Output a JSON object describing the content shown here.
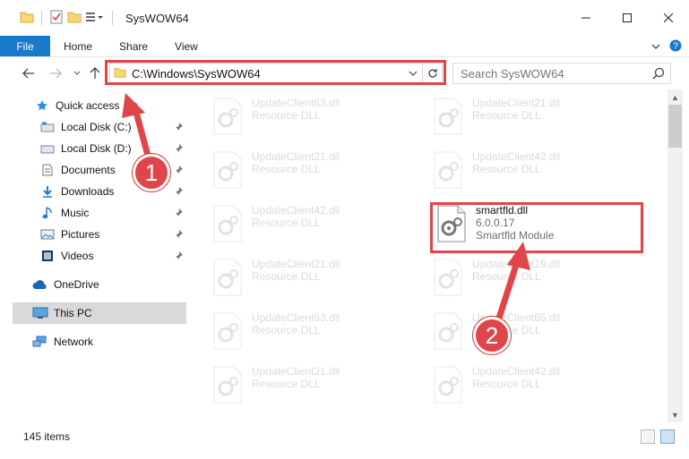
{
  "window": {
    "title": "SysWOW64"
  },
  "ribbon": {
    "tabs": [
      "File",
      "Home",
      "Share",
      "View"
    ]
  },
  "address": {
    "path": "C:\\Windows\\SysWOW64"
  },
  "search": {
    "placeholder": "Search SysWOW64"
  },
  "nav": {
    "quick_access": "Quick access",
    "items": [
      {
        "label": "Local Disk (C:)",
        "icon": "drive-icon",
        "pinned": true
      },
      {
        "label": "Local Disk (D:)",
        "icon": "drive-icon",
        "pinned": true
      },
      {
        "label": "Documents",
        "icon": "documents-icon",
        "pinned": true
      },
      {
        "label": "Downloads",
        "icon": "downloads-icon",
        "pinned": true
      },
      {
        "label": "Music",
        "icon": "music-icon",
        "pinned": true
      },
      {
        "label": "Pictures",
        "icon": "pictures-icon",
        "pinned": true
      },
      {
        "label": "Videos",
        "icon": "videos-icon",
        "pinned": true
      }
    ],
    "onedrive": "OneDrive",
    "this_pc": "This PC",
    "network": "Network"
  },
  "files": {
    "left": [
      {
        "name": "UpdateClient63.dll",
        "desc": "Resource DLL"
      },
      {
        "name": "UpdateClient21.dll",
        "desc": "Resource DLL"
      },
      {
        "name": "UpdateClient42.dll",
        "desc": "Resource DLL"
      },
      {
        "name": "UpdateClient21.dll",
        "desc": "Resource DLL"
      },
      {
        "name": "UpdateClient63.dll",
        "desc": "Resource DLL"
      },
      {
        "name": "UpdateClient21.dll",
        "desc": "Resource DLL"
      }
    ],
    "right": [
      {
        "name": "UpdateClient21.dll",
        "desc": "Resource DLL"
      },
      {
        "name": "UpdateClient42.dll",
        "desc": "Resource DLL"
      },
      {
        "name": "UpdateClient19.dll",
        "desc": "Resource DLL"
      },
      {
        "name": "UpdateClient65.dll",
        "desc": "Resource DLL"
      },
      {
        "name": "UpdateClient42.dll",
        "desc": "Resource DLL"
      }
    ],
    "highlighted": {
      "name": "smartfld.dll",
      "version": "6.0.0.17",
      "desc": "Smartfld Module"
    }
  },
  "status": {
    "count": "145 items"
  },
  "steps": {
    "one": "1",
    "two": "2"
  },
  "colors": {
    "accent": "#1979ca",
    "highlight": "#e0454a"
  }
}
